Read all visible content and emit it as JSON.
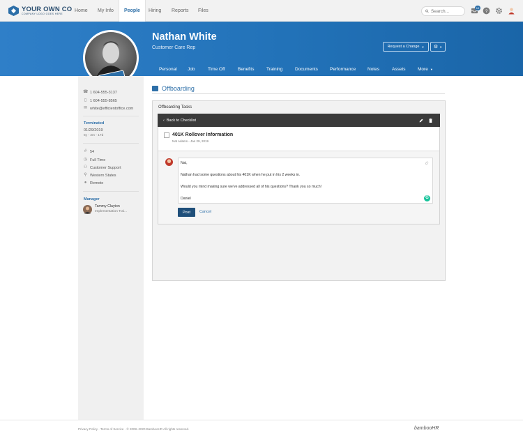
{
  "brand": {
    "name": "YOUR OWN CO",
    "tagline": "COMPANY LOGO GOES HERE"
  },
  "nav": {
    "items": [
      {
        "label": "Home"
      },
      {
        "label": "My Info"
      },
      {
        "label": "People"
      },
      {
        "label": "Hiring"
      },
      {
        "label": "Reports"
      },
      {
        "label": "Files"
      }
    ],
    "active": "People",
    "search_placeholder": "Search...",
    "inbox_badge": "10"
  },
  "employee": {
    "name": "Nathan White",
    "title": "Customer Care Rep",
    "request_change_label": "Request a Change",
    "tabs": [
      "Personal",
      "Job",
      "Time Off",
      "Benefits",
      "Training",
      "Documents",
      "Performance",
      "Notes",
      "Assets",
      "More"
    ]
  },
  "sidebar": {
    "work_phone": "1 604-555-3137",
    "mobile_phone": "1 604-555-8565",
    "email": "white@efficientoffice.com",
    "status_label": "Terminated",
    "status_date": "01/29/2019",
    "status_duration": "5y - 2m - 17d",
    "employee_number": "54",
    "employment_type": "Full Time",
    "department": "Customer Support",
    "division": "Western States",
    "location": "Remote",
    "manager_label": "Manager",
    "manager_name": "Tammy Clayton",
    "manager_title": "Implementation Trai..."
  },
  "section": {
    "title": "Offboarding",
    "panel_title": "Offboarding Tasks",
    "back_label": "Back to Checklist",
    "task_title": "401K Rollover Information",
    "task_meta": "Nat Adams - Jan 29, 2019"
  },
  "comment": {
    "lines": [
      "Nat,",
      "Nathan had some questions about his 401K when he put in his 2 weeks in.",
      "Would you mind making sure we've addressed all of his questions? Thank you so much!",
      "Daniel"
    ],
    "post_label": "Post",
    "cancel_label": "Cancel"
  },
  "footer": {
    "text": "Privacy Policy  ·  Terms of Service  ·  © 2008–2020 BambooHR All rights reserved.",
    "bamboo_logo": "bambooHR"
  },
  "colors": {
    "accent": "#2d6fa8",
    "banner": "#2272b8",
    "dark_bar": "#3a3a3a",
    "post_button": "#1f4f7a"
  }
}
